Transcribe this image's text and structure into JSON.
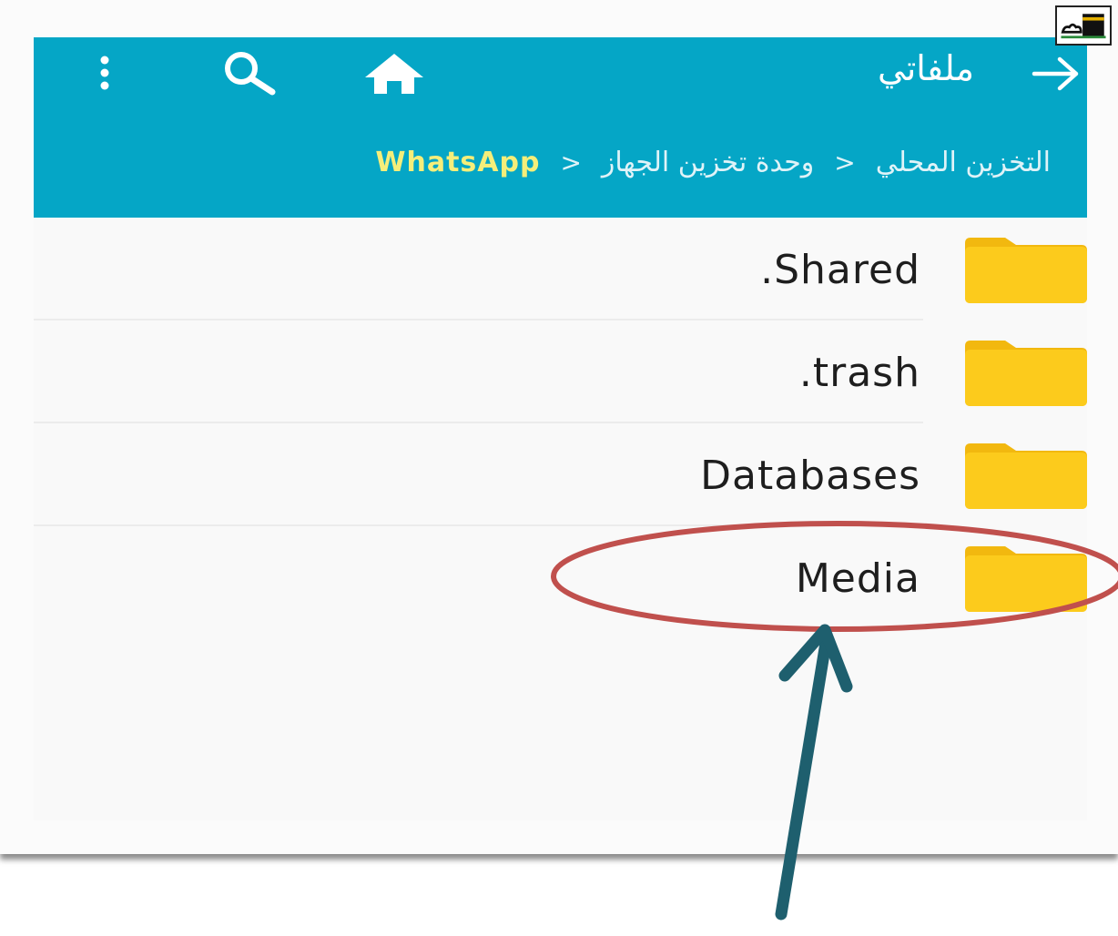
{
  "toolbar": {
    "title": "ملفاتي",
    "back_icon": "arrow-right-icon",
    "home_icon": "home-icon",
    "search_icon": "search-icon",
    "more_icon": "more-vert-icon",
    "background_color": "#05a6c6"
  },
  "breadcrumb": {
    "items": [
      "التخزين المحلي",
      "وحدة تخزين الجهاز",
      "WhatsApp"
    ],
    "separator": ">",
    "current_color": "#f5ee7a"
  },
  "files": [
    {
      "name": ".Shared",
      "icon": "folder-icon"
    },
    {
      "name": ".trash",
      "icon": "folder-icon"
    },
    {
      "name": "Databases",
      "icon": "folder-icon"
    },
    {
      "name": "Media",
      "icon": "folder-icon"
    }
  ],
  "colors": {
    "folder": "#fccb1c",
    "annotation_ellipse": "#c0504d",
    "annotation_arrow": "#1e5f6e"
  },
  "annotation": {
    "highlight": "ellipse-around-media",
    "arrow": "arrow-pointing-up-at-media"
  }
}
